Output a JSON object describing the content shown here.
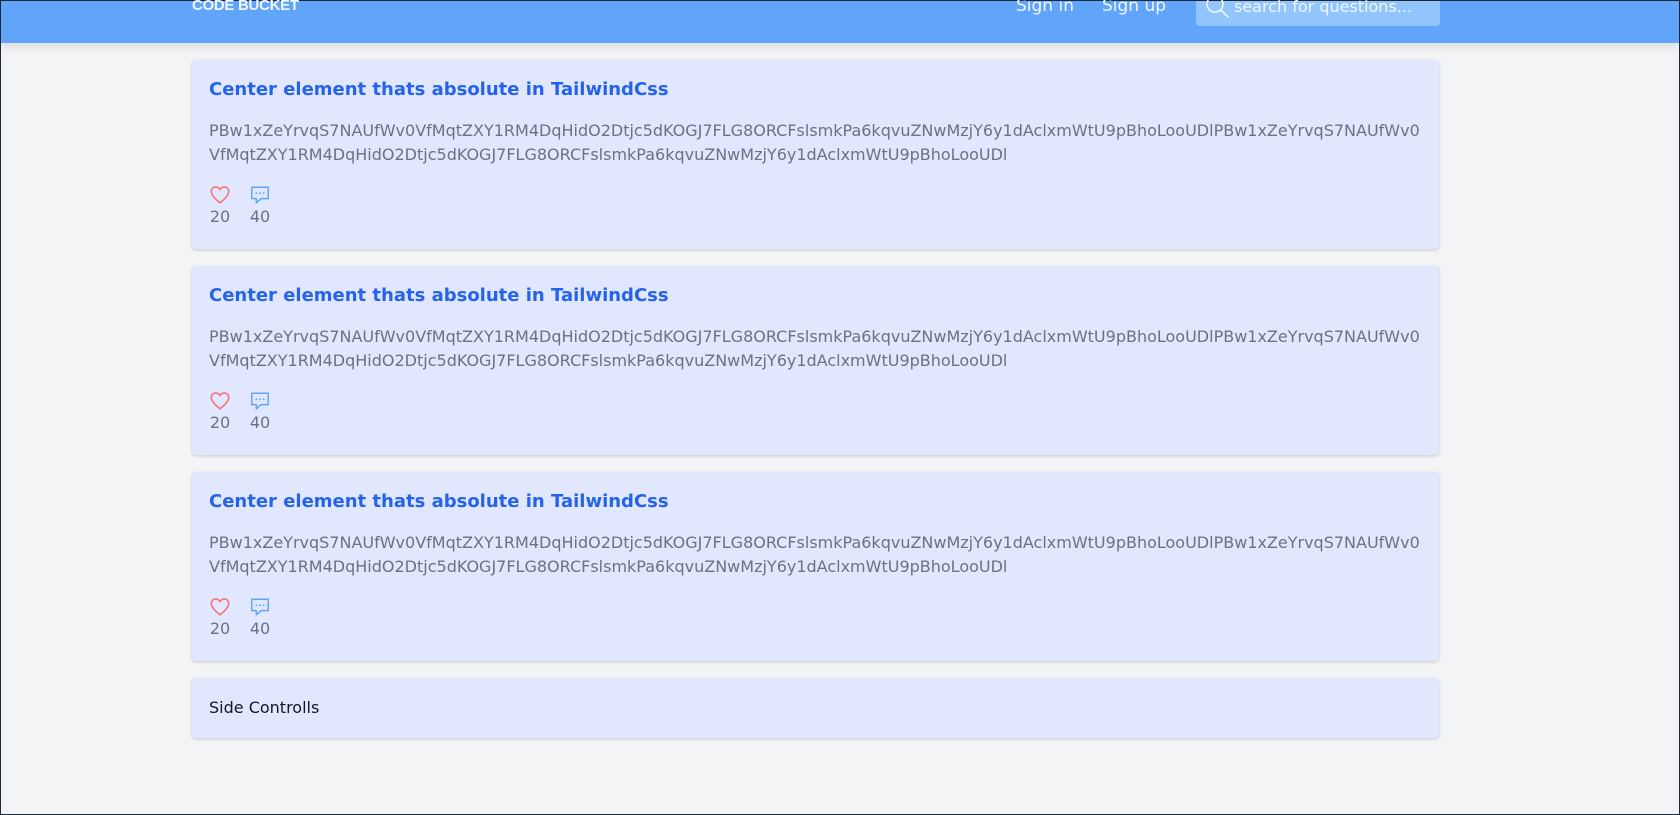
{
  "navbar": {
    "brand": "CODE BUCKET",
    "sign_in": "Sign in",
    "sign_up": "Sign up",
    "search_placeholder": "search for questions...",
    "color": "#60a5fa"
  },
  "posts": [
    {
      "title": "Center element thats absolute in TailwindCss",
      "body": "PBw1xZeYrvqS7NAUfWv0VfMqtZXY1RM4DqHidO2Dtjc5dKOGJ7FLG8ORCFslsmkPa6kqvuZNwMzjY6y1dAclxmWtU9pBhoLooUDlPBw1xZeYrvqS7NAUfWv0VfMqtZXY1RM4DqHidO2Dtjc5dKOGJ7FLG8ORCFslsmkPa6kqvuZNwMzjY6y1dAclxmWtU9pBhoLooUDl",
      "likes": "20",
      "comments": "40"
    },
    {
      "title": "Center element thats absolute in TailwindCss",
      "body": "PBw1xZeYrvqS7NAUfWv0VfMqtZXY1RM4DqHidO2Dtjc5dKOGJ7FLG8ORCFslsmkPa6kqvuZNwMzjY6y1dAclxmWtU9pBhoLooUDlPBw1xZeYrvqS7NAUfWv0VfMqtZXY1RM4DqHidO2Dtjc5dKOGJ7FLG8ORCFslsmkPa6kqvuZNwMzjY6y1dAclxmWtU9pBhoLooUDl",
      "likes": "20",
      "comments": "40"
    },
    {
      "title": "Center element thats absolute in TailwindCss",
      "body": "PBw1xZeYrvqS7NAUfWv0VfMqtZXY1RM4DqHidO2Dtjc5dKOGJ7FLG8ORCFslsmkPa6kqvuZNwMzjY6y1dAclxmWtU9pBhoLooUDlPBw1xZeYrvqS7NAUfWv0VfMqtZXY1RM4DqHidO2Dtjc5dKOGJ7FLG8ORCFslsmkPa6kqvuZNwMzjY6y1dAclxmWtU9pBhoLooUDl",
      "likes": "20",
      "comments": "40"
    }
  ],
  "side_controls": {
    "label": "Side Controlls"
  },
  "icons": {
    "like": "heart-icon",
    "comment": "chat-bubble-icon",
    "search": "search-icon"
  },
  "colors": {
    "card_bg": "#e0e7ff",
    "title": "#2563eb",
    "heart": "#f87171",
    "comment": "#60a5fa"
  }
}
